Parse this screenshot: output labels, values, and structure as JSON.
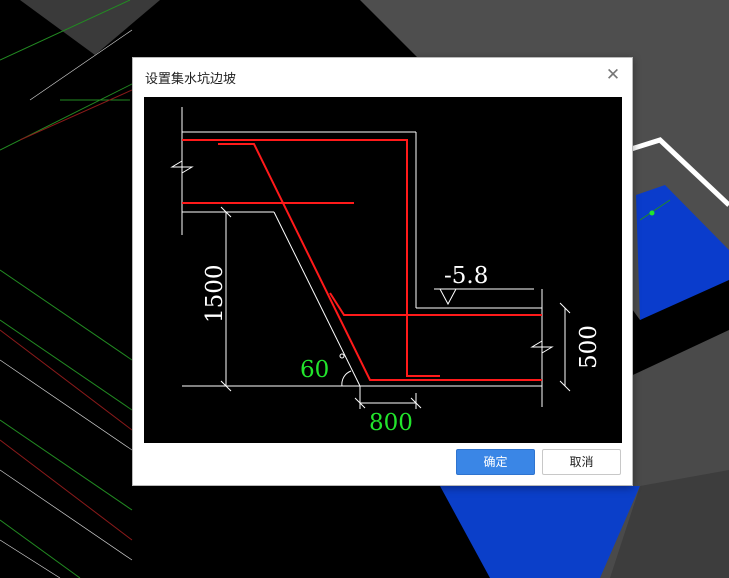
{
  "dialog": {
    "title": "设置集水坑边坡",
    "close_glyph": "✕",
    "ok_label": "确定",
    "cancel_label": "取消"
  },
  "diagram": {
    "elevation_label": "-5.8",
    "depth_label": "1500",
    "slope_angle_label": "60",
    "bottom_width_label": "800",
    "side_height_label": "500"
  },
  "colors": {
    "rebar": "#ff1a1a",
    "outline": "#ffffff",
    "dimension_highlight": "#22e52c",
    "primary_button": "#3a86e6",
    "background": "#000000",
    "model_gray": "#555555",
    "model_blue": "#0a3ccc"
  }
}
